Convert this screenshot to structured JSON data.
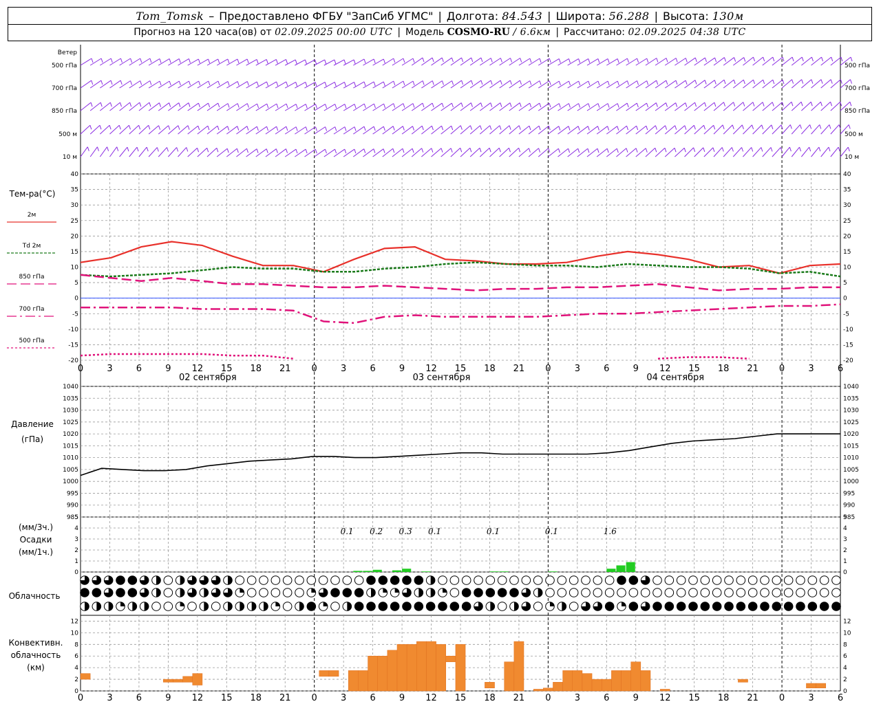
{
  "header": {
    "station": "Tom_Tomsk",
    "dash": "–",
    "provided": "Предоставлено ФГБУ \"ЗапСиб УГМС\"",
    "lon_label": "Долгота:",
    "lon": "84.543",
    "lat_label": "Широта:",
    "lat": "56.288",
    "alt_label": "Высота:",
    "alt": "130м",
    "forecast_label": "Прогноз на 120 часа(ов) от",
    "forecast_time": "02.09.2025 00:00 UTC",
    "model_label": "Модель",
    "model": "COSMO-RU",
    "model_res": "/ 6.6км",
    "calc_label": "Рассчитано:",
    "calc_time": "02.09.2025 04:38 UTC"
  },
  "colors": {
    "wind": "#8a2be2",
    "t2m": "#e8302a",
    "td2m": "#1a7a1a",
    "t850": "#e0127a",
    "t700": "#e0127a",
    "t500": "#e0127a",
    "zero_line": "#3050ff",
    "pressure": "#000000",
    "precip": "#22cc22",
    "convective": "#f08a30",
    "grid": "#999999"
  },
  "chart_data": [
    {
      "type": "wind_barbs",
      "title": "Ветер",
      "levels": [
        "500 гПа",
        "700 гПа",
        "850 гПа",
        "500 м",
        "10  м"
      ],
      "step_hours": 1,
      "hours": 126,
      "direction_deg_by_level": [
        [
          270,
          270,
          275,
          280,
          280,
          285,
          290,
          290,
          280,
          270,
          260,
          260,
          265,
          270,
          275,
          275,
          270,
          265,
          260,
          255,
          250,
          250,
          250,
          250
        ],
        [
          260,
          265,
          270,
          270,
          275,
          280,
          285,
          285,
          280,
          270,
          265,
          260,
          260,
          265,
          270,
          270,
          265,
          260,
          255,
          250,
          250,
          245,
          245,
          245
        ],
        [
          250,
          250,
          255,
          260,
          265,
          270,
          275,
          275,
          270,
          265,
          260,
          255,
          255,
          260,
          265,
          265,
          260,
          255,
          250,
          245,
          245,
          240,
          240,
          240
        ],
        [
          240,
          240,
          245,
          250,
          255,
          260,
          265,
          265,
          260,
          255,
          250,
          245,
          245,
          250,
          255,
          255,
          250,
          245,
          240,
          235,
          235,
          230,
          230,
          230
        ],
        [
          220,
          225,
          230,
          240,
          250,
          255,
          260,
          260,
          255,
          250,
          245,
          240,
          240,
          245,
          250,
          250,
          245,
          240,
          235,
          230,
          230,
          225,
          225,
          225
        ]
      ]
    },
    {
      "type": "line",
      "ylabel": "Тем-ра(°С)",
      "ylim": [
        -20,
        40
      ],
      "yticks": [
        -20,
        -15,
        -10,
        -5,
        0,
        5,
        10,
        15,
        20,
        25,
        30,
        35,
        40
      ],
      "x_ticks": [
        "0",
        "3",
        "6",
        "9",
        "12",
        "15",
        "18",
        "21",
        "0",
        "3",
        "6",
        "9",
        "12",
        "15",
        "18",
        "21",
        "0",
        "3",
        "6",
        "9",
        "12",
        "15",
        "18",
        "21",
        "0",
        "3",
        "6"
      ],
      "dates": [
        "02 сентября",
        "03 сентября",
        "04 сентября"
      ],
      "x_hours": [
        0,
        3,
        6,
        9,
        12,
        15,
        18,
        21,
        24,
        27,
        30,
        33,
        36,
        39,
        42,
        45,
        48,
        51,
        54,
        57,
        60,
        63,
        66,
        69,
        72,
        75,
        78
      ],
      "series": [
        {
          "name": "2м",
          "values": [
            11.5,
            13,
            16.5,
            18.2,
            17,
            13.5,
            10.5,
            10.5,
            8.5,
            12.5,
            16,
            16.5,
            12.5,
            12,
            11,
            11,
            11.5,
            13.5,
            15,
            14,
            12.5,
            10,
            10.5,
            8,
            10.5,
            11
          ]
        },
        {
          "name": "Td  2м",
          "values": [
            7.5,
            7,
            7.5,
            8,
            9,
            10,
            9.5,
            9.5,
            8.5,
            8.5,
            9.5,
            10,
            11,
            11.5,
            11,
            10.5,
            10.5,
            10,
            11,
            10.5,
            10,
            10,
            9.5,
            8,
            8.5,
            7
          ]
        },
        {
          "name": "850 гПа",
          "values": [
            7.5,
            6.5,
            5.5,
            6.5,
            5.5,
            4.5,
            4.5,
            4,
            3.5,
            3.5,
            4,
            3.5,
            3,
            2.5,
            3,
            3,
            3.5,
            3.5,
            4,
            4.5,
            3.5,
            2.5,
            3,
            3,
            3.5,
            3.5
          ]
        },
        {
          "name": "700 гПа",
          "values": [
            -3,
            -3,
            -3,
            -3,
            -3.5,
            -3.5,
            -3.5,
            -4,
            -7.5,
            -8,
            -6,
            -5.5,
            -6,
            -6,
            -6,
            -6,
            -5.5,
            -5,
            -5,
            -4.5,
            -4,
            -3.5,
            -3,
            -2.5,
            -2.5,
            -2
          ]
        },
        {
          "name": "500 гПа",
          "values": [
            -18.5,
            -18,
            -18,
            -18,
            -18,
            -18.5,
            -18.5,
            -19.5,
            null,
            null,
            null,
            null,
            null,
            null,
            null,
            null,
            null,
            null,
            null,
            -19.5,
            -19,
            -19,
            -19.5,
            null,
            null,
            null
          ]
        }
      ]
    },
    {
      "type": "line",
      "ylabel": "Давление",
      "yunit": "(гПа)",
      "ylim": [
        985,
        1040
      ],
      "yticks": [
        985,
        990,
        995,
        1000,
        1005,
        1010,
        1015,
        1020,
        1025,
        1030,
        1035,
        1040
      ],
      "series": [
        {
          "name": "Давление",
          "values": [
            1002.5,
            1005.5,
            1005,
            1004.5,
            1004.5,
            1005,
            1006.5,
            1007.5,
            1008.5,
            1009,
            1009.5,
            1010.5,
            1010.5,
            1010,
            1010,
            1010.5,
            1011,
            1011.5,
            1012,
            1012,
            1011.5,
            1011.5,
            1011.5,
            1011.5,
            1011.5,
            1012,
            1013,
            1014.5,
            1016,
            1017,
            1017.5,
            1018,
            1019,
            1020,
            1020,
            1020,
            1020
          ]
        }
      ]
    },
    {
      "type": "bar",
      "ylabel": "(мм/3ч.)",
      "ylabel2": "Осадки",
      "ylabel3": "(мм/1ч.)",
      "ylim": [
        0,
        5
      ],
      "yticks": [
        0,
        1,
        2,
        3,
        4,
        5
      ],
      "sums_3h": [
        {
          "hour": 27,
          "value": "0.1"
        },
        {
          "hour": 30,
          "value": "0.2"
        },
        {
          "hour": 33,
          "value": "0.3"
        },
        {
          "hour": 36,
          "value": "0.1"
        },
        {
          "hour": 42,
          "value": "0.1"
        },
        {
          "hour": 48,
          "value": "0.1"
        },
        {
          "hour": 54,
          "value": "1.6"
        }
      ],
      "hourly": [
        {
          "hour": 29,
          "value": 0.1
        },
        {
          "hour": 30,
          "value": 0.1
        },
        {
          "hour": 31,
          "value": 0.2
        },
        {
          "hour": 33,
          "value": 0.15
        },
        {
          "hour": 34,
          "value": 0.3
        },
        {
          "hour": 36,
          "value": 0.05
        },
        {
          "hour": 43,
          "value": 0.05
        },
        {
          "hour": 44,
          "value": 0.05
        },
        {
          "hour": 49,
          "value": 0.05
        },
        {
          "hour": 55,
          "value": 0.3
        },
        {
          "hour": 56,
          "value": 0.6
        },
        {
          "hour": 57,
          "value": 0.9
        }
      ]
    },
    {
      "type": "cloud_symbols",
      "ylabel": "Облачность",
      "rows": 3,
      "cover_fraction_rows": [
        [
          0.75,
          0.75,
          0.75,
          1,
          1,
          0.75,
          0.5,
          0,
          0.5,
          0.75,
          0.75,
          0.75,
          0.5,
          0,
          0,
          0,
          0,
          0,
          0,
          0,
          0,
          0,
          0,
          0,
          1,
          1,
          1,
          1,
          1,
          0.5,
          0,
          0,
          0,
          0,
          0,
          0,
          0,
          0,
          0,
          0,
          0,
          0,
          0,
          0,
          0,
          1,
          1,
          0.75,
          0,
          0,
          0,
          0,
          0,
          0,
          0,
          0,
          0,
          0,
          0,
          0,
          0,
          0,
          0,
          0
        ],
        [
          1,
          1,
          0.75,
          1,
          1,
          0.75,
          0.5,
          0,
          0.5,
          0.75,
          0.5,
          0.75,
          0.75,
          0.25,
          0,
          0,
          0,
          0,
          0,
          0.25,
          0.75,
          1,
          1,
          1,
          0.5,
          0.25,
          0.25,
          0.75,
          0.5,
          0.5,
          0.25,
          0,
          1,
          1,
          1,
          1,
          1,
          0.75,
          0.5,
          0,
          0,
          0,
          0,
          0,
          0,
          0,
          0,
          0,
          0,
          0,
          0,
          0,
          0,
          0,
          0,
          0,
          0,
          0,
          0,
          0,
          0,
          0,
          0,
          0
        ],
        [
          0.5,
          0.5,
          0.5,
          0.25,
          0.5,
          0.5,
          0,
          0,
          0.25,
          0,
          0.5,
          0,
          0.5,
          0.5,
          0.5,
          0.5,
          0.25,
          0,
          0.5,
          1,
          0.25,
          0,
          0.5,
          1,
          1,
          1,
          1,
          1,
          1,
          1,
          1,
          1,
          1,
          0.75,
          0.5,
          0,
          0.5,
          0.75,
          0,
          0.25,
          0.5,
          0,
          0.75,
          0.75,
          1,
          0.25,
          1,
          0.75,
          1,
          1,
          1,
          1,
          1,
          1,
          1,
          1,
          1,
          1,
          1,
          1,
          1,
          1,
          1,
          1
        ]
      ]
    },
    {
      "type": "bar",
      "ylabel": "Конвективн.",
      "ylabel2": "облачность",
      "ylabel3": "(км)",
      "ylim": [
        0,
        13
      ],
      "yticks": [
        0,
        2,
        4,
        6,
        8,
        10,
        12
      ],
      "bars": [
        {
          "hour": 0.5,
          "bottom": 2,
          "top": 3
        },
        {
          "hour": 9,
          "bottom": 1.5,
          "top": 2
        },
        {
          "hour": 10,
          "bottom": 1.5,
          "top": 2
        },
        {
          "hour": 11,
          "bottom": 1.5,
          "top": 2.5
        },
        {
          "hour": 12,
          "bottom": 1,
          "top": 3
        },
        {
          "hour": 25,
          "bottom": 2.5,
          "top": 3.5
        },
        {
          "hour": 26,
          "bottom": 2.5,
          "top": 3.5
        },
        {
          "hour": 28,
          "bottom": 0,
          "top": 3.5
        },
        {
          "hour": 29,
          "bottom": 0,
          "top": 3.5
        },
        {
          "hour": 30,
          "bottom": 0,
          "top": 6
        },
        {
          "hour": 31,
          "bottom": 0,
          "top": 6
        },
        {
          "hour": 32,
          "bottom": 0,
          "top": 7
        },
        {
          "hour": 33,
          "bottom": 0,
          "top": 8
        },
        {
          "hour": 34,
          "bottom": 0,
          "top": 8
        },
        {
          "hour": 35,
          "bottom": 0,
          "top": 8.5
        },
        {
          "hour": 36,
          "bottom": 0,
          "top": 8.5
        },
        {
          "hour": 37,
          "bottom": 0,
          "top": 8
        },
        {
          "hour": 38,
          "bottom": 5,
          "top": 6
        },
        {
          "hour": 39,
          "bottom": 0,
          "top": 8
        },
        {
          "hour": 42,
          "bottom": 0.5,
          "top": 1.5
        },
        {
          "hour": 44,
          "bottom": 0,
          "top": 5
        },
        {
          "hour": 45,
          "bottom": 0,
          "top": 8.5
        },
        {
          "hour": 47,
          "bottom": 0,
          "top": 0.3
        },
        {
          "hour": 48,
          "bottom": 0,
          "top": 0.5
        },
        {
          "hour": 49,
          "bottom": 0,
          "top": 1.5
        },
        {
          "hour": 50,
          "bottom": 0,
          "top": 3.5
        },
        {
          "hour": 51,
          "bottom": 0,
          "top": 3.5
        },
        {
          "hour": 52,
          "bottom": 0,
          "top": 3
        },
        {
          "hour": 53,
          "bottom": 0,
          "top": 2
        },
        {
          "hour": 54,
          "bottom": 0,
          "top": 2
        },
        {
          "hour": 55,
          "bottom": 0,
          "top": 3.5
        },
        {
          "hour": 56,
          "bottom": 0,
          "top": 3.5
        },
        {
          "hour": 57,
          "bottom": 0,
          "top": 5
        },
        {
          "hour": 58,
          "bottom": 0,
          "top": 3.5
        },
        {
          "hour": 60,
          "bottom": 0,
          "top": 0.3
        },
        {
          "hour": 68,
          "bottom": 1.5,
          "top": 2
        },
        {
          "hour": 75,
          "bottom": 0.5,
          "top": 1.3
        },
        {
          "hour": 76,
          "bottom": 0.5,
          "top": 1.3
        }
      ]
    }
  ]
}
